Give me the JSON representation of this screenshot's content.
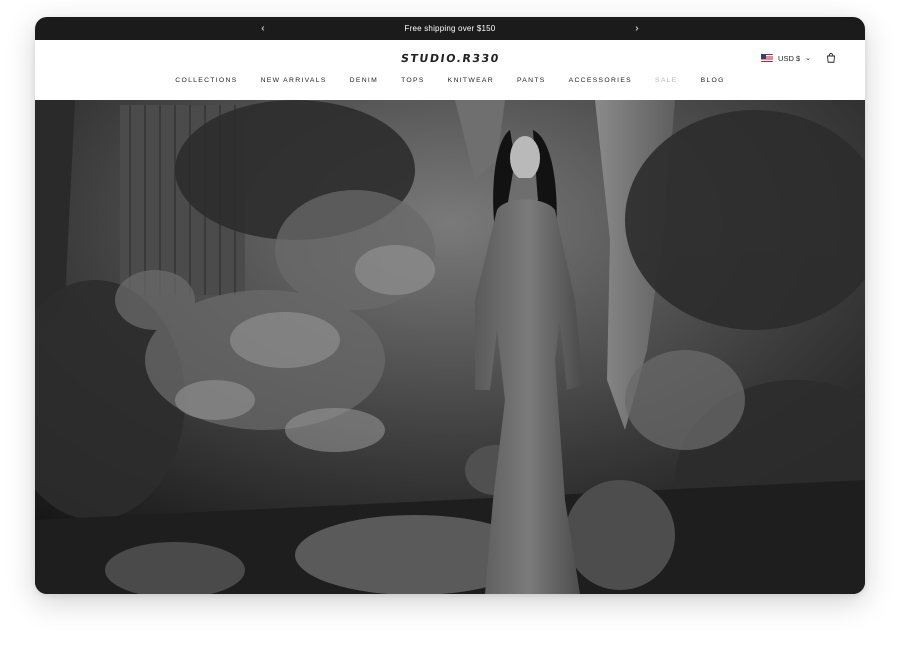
{
  "announcement": {
    "text": "Free shipping over $150",
    "prev_icon": "chevron-left-icon",
    "next_icon": "chevron-right-icon"
  },
  "brand": {
    "logo_text": "STUDIO.R330"
  },
  "utility": {
    "currency": "USD $",
    "flag": "us-flag-icon",
    "cart_icon": "shopping-bag-icon"
  },
  "nav": {
    "items": [
      {
        "label": "COLLECTIONS"
      },
      {
        "label": "NEW ARRIVALS"
      },
      {
        "label": "DENIM"
      },
      {
        "label": "TOPS"
      },
      {
        "label": "KNITWEAR"
      },
      {
        "label": "PANTS"
      },
      {
        "label": "ACCESSORIES"
      },
      {
        "label": "SALE"
      },
      {
        "label": "BLOG"
      }
    ]
  },
  "hero": {
    "image": "black-and-white garden photo of a model in a long knit dress"
  },
  "colors": {
    "announce_bg": "#1b1b1b",
    "text": "#222222",
    "muted": "#b7b7b7"
  }
}
